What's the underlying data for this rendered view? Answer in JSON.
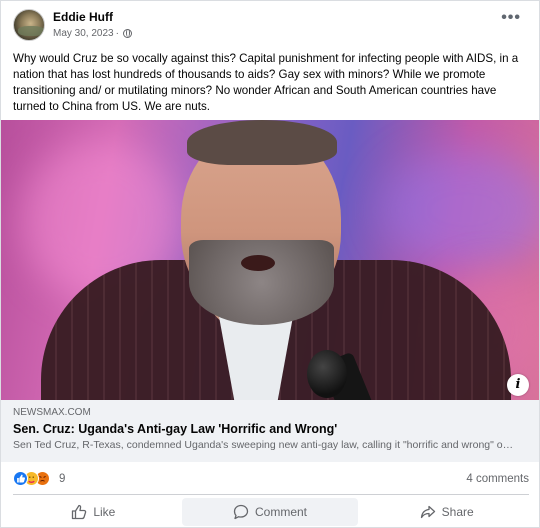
{
  "post": {
    "author": "Eddie Huff",
    "date": "May 30, 2023",
    "separator": "·",
    "text": "Why would Cruz be so vocally against this? Capital punishment for infecting people with AIDS, in a nation that has lost hundreds of thousands to aids? Gay sex with minors? While we promote transitioning and/ or mutilating minors?  No wonder African and South American countries have turned to China from US. We are nuts."
  },
  "link": {
    "domain": "NEWSMAX.COM",
    "title": "Sen. Cruz: Uganda's Anti-gay Law 'Horrific and Wrong'",
    "description": "Sen Ted Cruz, R-Texas, condemned Uganda's sweeping new anti-gay law, calling it \"horrific and wrong\" on Tuesday."
  },
  "engagement": {
    "reaction_count": "9",
    "comments": "4 comments"
  },
  "actions": {
    "like": "Like",
    "comment": "Comment",
    "share": "Share"
  },
  "icons": {
    "more": "more-options-icon",
    "audience": "globe-icon",
    "info": "info-icon"
  },
  "colors": {
    "like_blue": "#1877f2",
    "link_bg": "#f0f2f5",
    "secondary_text": "#65676b"
  }
}
